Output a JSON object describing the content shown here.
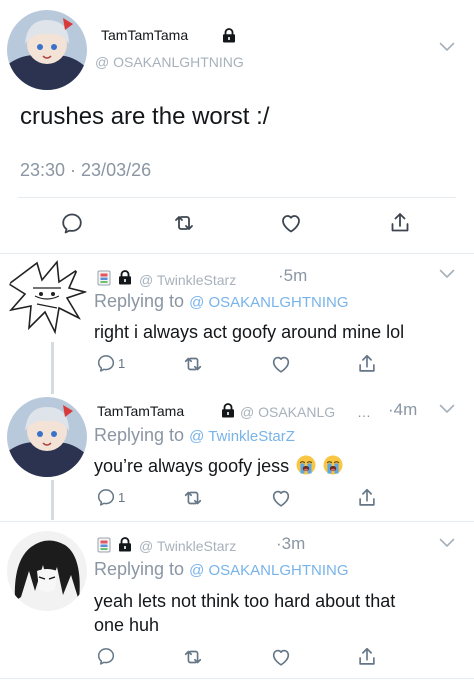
{
  "main_tweet": {
    "display_name": "TamTamTama",
    "handle": "@ OSAKANLGHTNING",
    "text": "crushes are the worst :/",
    "timestamp": "23:30 · 23/03/26",
    "actions": [
      "reply-icon",
      "retweet-icon",
      "like-icon",
      "share-icon"
    ]
  },
  "replies": [
    {
      "display_name_icons": [
        "pad-icon",
        "lock-icon"
      ],
      "handle": "@ TwinkleStarz",
      "time": "·5m",
      "replying_label": "Replying to",
      "replying_to": "@ OSAKANLGHTNING",
      "text": "right i always act goofy around mine lol",
      "reply_count": "1"
    },
    {
      "display_name": "TamTamTama",
      "handle": "@ OSAKANLG",
      "handle_ellipsis": "…",
      "time": "·4m",
      "replying_label": "Replying to",
      "replying_to": "@ TwinkleStarZ",
      "text": "you’re always goofy jess",
      "emoji": [
        "loudly-crying-face-emoji",
        "loudly-crying-face-emoji"
      ],
      "reply_count": "1"
    },
    {
      "display_name_icons": [
        "pad-icon",
        "lock-icon"
      ],
      "handle": "@ TwinkleStarz",
      "time": "·3m",
      "replying_label": "Replying to",
      "replying_to": "@ OSAKANLGHTNING",
      "text_line1": "yeah lets not think too hard about that",
      "text_line2": "one huh",
      "reply_count": ""
    }
  ],
  "colors": {
    "text": "#14171a",
    "muted": "#8a96a3",
    "handle": "#a7b1bb",
    "mention": "#78b3ea",
    "divider": "#e6ecf0",
    "thread": "#d4dbe1"
  }
}
